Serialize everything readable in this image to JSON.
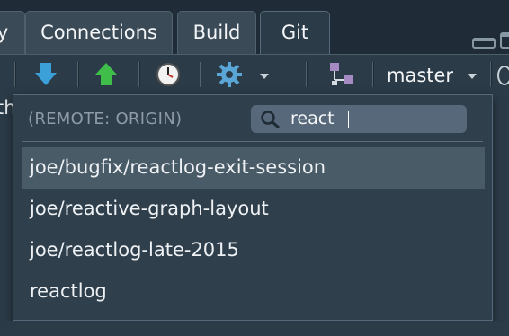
{
  "tabs": [
    {
      "label": "y",
      "active": false
    },
    {
      "label": "Connections",
      "active": false
    },
    {
      "label": "Build",
      "active": false
    },
    {
      "label": "Git",
      "active": true
    }
  ],
  "toolbar": {
    "icons": [
      "pull-arrow-icon",
      "push-arrow-icon",
      "history-clock-icon",
      "gear-icon",
      "new-branch-icon"
    ],
    "branch_label": "master"
  },
  "left_partial_text": "th",
  "dropdown": {
    "remote_label": "(REMOTE: ORIGIN)",
    "search_value": "react",
    "branches": [
      {
        "name": "joe/bugfix/reactlog-exit-session",
        "selected": true
      },
      {
        "name": "joe/reactive-graph-layout",
        "selected": false
      },
      {
        "name": "joe/reactlog-late-2015",
        "selected": false
      },
      {
        "name": "reactlog",
        "selected": false
      }
    ]
  },
  "colors": {
    "pull_arrow": "#3b9fd8",
    "push_arrow": "#3fbf4a",
    "panel_bg": "#2f3f4c",
    "selected_row": "#4a5b68"
  }
}
